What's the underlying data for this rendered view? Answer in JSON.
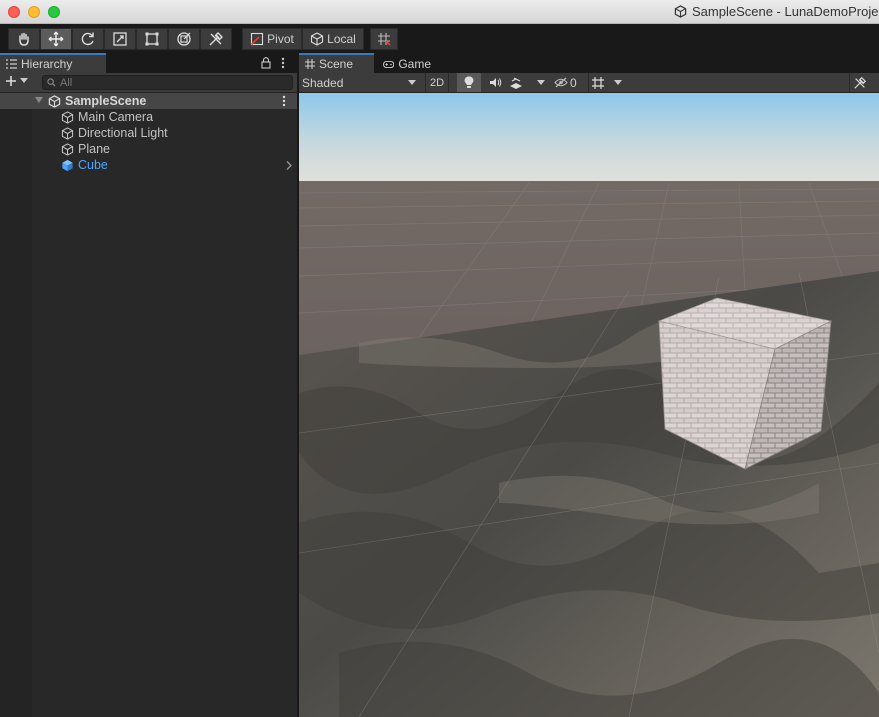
{
  "window": {
    "title": "SampleScene - LunaDemoProje"
  },
  "toolbar": {
    "tools": [
      "hand-icon",
      "move-icon",
      "rotate-icon",
      "scale-icon",
      "rect-icon",
      "transform-icon",
      "custom-tool-icon"
    ],
    "active_tool": "move-icon",
    "pivot_label": "Pivot",
    "local_label": "Local"
  },
  "hierarchy": {
    "tab_label": "Hierarchy",
    "search_placeholder": "All",
    "scene_name": "SampleScene",
    "items": [
      {
        "label": "Main Camera",
        "selected": false
      },
      {
        "label": "Directional Light",
        "selected": false
      },
      {
        "label": "Plane",
        "selected": false
      },
      {
        "label": "Cube",
        "selected": true
      }
    ]
  },
  "scene_view": {
    "tabs": [
      {
        "label": "Scene",
        "active": true
      },
      {
        "label": "Game",
        "active": false
      }
    ],
    "draw_mode": "Shaded",
    "mode_2d_label": "2D",
    "hidden_count": "0"
  },
  "colors": {
    "selection_blue": "#4fa3ff",
    "tab_accent": "#3a79bb",
    "panel_bg": "#282828",
    "toolbar_bg": "#3c3c3c",
    "sky_top": "#8ec8ea",
    "ground": "#6b6462"
  }
}
